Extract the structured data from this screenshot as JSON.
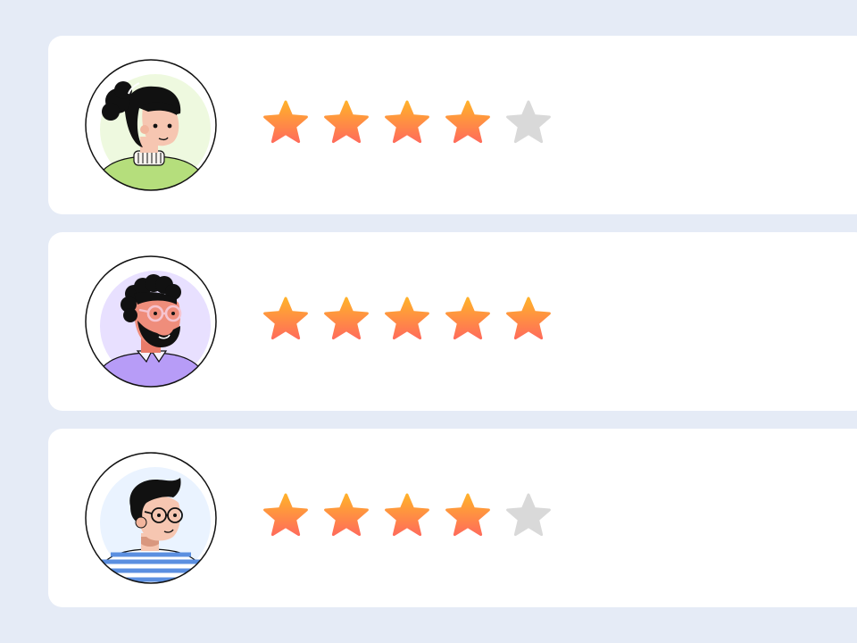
{
  "colors": {
    "background": "#e5ebf6",
    "card": "#ffffff",
    "star_filled_top": "#ffb12b",
    "star_filled_bottom": "#ff6d5a",
    "star_empty": "#d9d9d9"
  },
  "reviews": [
    {
      "avatar": "woman-with-bun-avatar",
      "rating": 4,
      "max_rating": 5
    },
    {
      "avatar": "bearded-man-with-glasses-avatar",
      "rating": 5,
      "max_rating": 5
    },
    {
      "avatar": "man-with-round-glasses-avatar",
      "rating": 4,
      "max_rating": 5
    }
  ]
}
